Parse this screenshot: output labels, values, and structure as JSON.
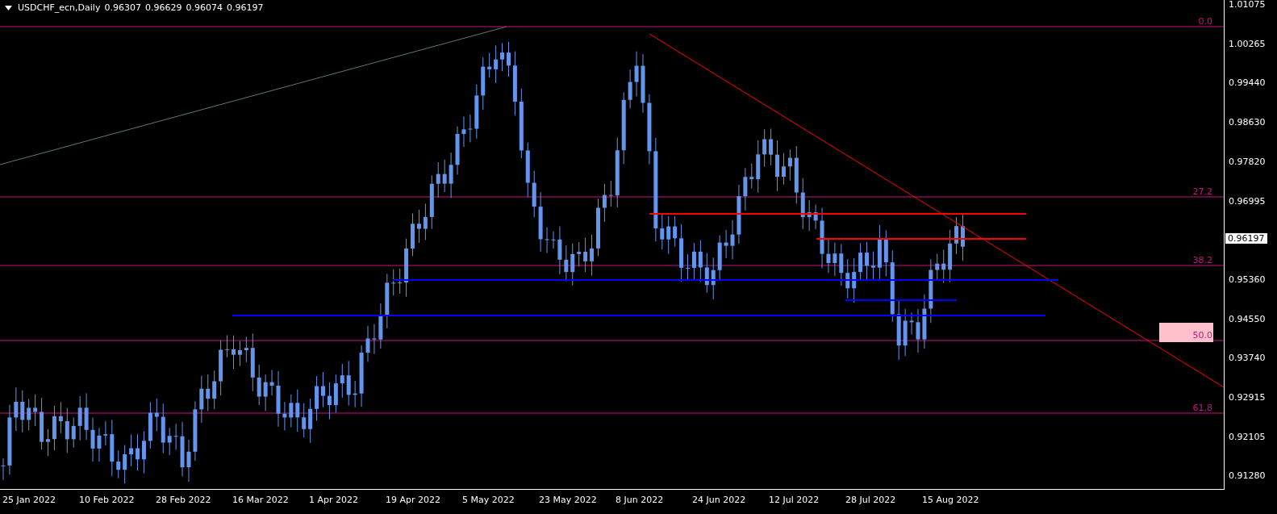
{
  "header": {
    "symbol": "USDCHF_ecn,Daily",
    "open": "0.96307",
    "high": "0.96629",
    "low": "0.96074",
    "close": "0.96197"
  },
  "price_axis": [
    "1.01075",
    "1.00265",
    "0.99440",
    "0.98630",
    "0.97820",
    "0.96995",
    "0.95360",
    "0.94550",
    "0.93740",
    "0.92915",
    "0.92105",
    "0.91280"
  ],
  "current_price": "0.96197",
  "fib_levels": [
    "0.0",
    "27.2",
    "38.2",
    "50.0",
    "61,8"
  ],
  "time_axis": [
    "25 Jan 2022",
    "10 Feb 2022",
    "28 Feb 2022",
    "16 Mar 2022",
    "1 Apr 2022",
    "19 Apr 2022",
    "5 May 2022",
    "23 May 2022",
    "8 Jun 2022",
    "24 Jun 2022",
    "12 Jul 2022",
    "28 Jul 2022",
    "15 Aug 2022"
  ]
}
